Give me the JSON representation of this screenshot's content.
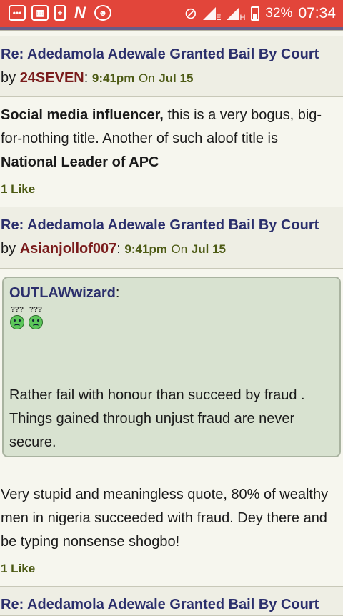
{
  "status_bar": {
    "battery": "32%",
    "time": "07:34",
    "net_e": "E",
    "net_h": "H",
    "icons": [
      "messages-icon",
      "gallery-icon",
      "battery-saver-icon",
      "news-icon",
      "game-icon",
      "no-disturb-icon",
      "signal-icon",
      "signal-icon"
    ]
  },
  "posts": [
    {
      "title": "Re: Adedamola Adewale Granted Bail By Court",
      "by": "by",
      "user": "24SEVEN",
      "colon": ":",
      "time": "9:41pm",
      "on": "On",
      "date": "Jul 15",
      "body_bold_1": "Social media influencer,",
      "body_1": " this is a very bogus, big-for-nothing title. Another of such aloof title is",
      "body_bold_2": "National Leader of APC",
      "likes": "1 Like"
    },
    {
      "title": "Re: Adedamola Adewale Granted Bail By Court",
      "by": "by",
      "user": "Asianjollof007",
      "colon": ":",
      "time": "9:41pm",
      "on": "On",
      "date": "Jul 15",
      "quote_user": "OUTLAWwizard",
      "quote_colon": ":",
      "smiley_marks": "???",
      "quote_text": "Rather fail with honour than succeed by fraud . Things gained through unjust fraud are never secure.",
      "body": "Very stupid and meaningless quote, 80% of wealthy men in nigeria succeeded with fraud. Dey there and be typing nonsense shogbo!",
      "likes": "1 Like"
    },
    {
      "title": "Re: Adedamola Adewale Granted Bail By Court"
    }
  ],
  "colors": {
    "status_bar": "#e2453a",
    "title": "#2b2f6c",
    "username": "#7a1c1c",
    "meta": "#4c5a14",
    "quote_bg": "#d8e2d0"
  }
}
